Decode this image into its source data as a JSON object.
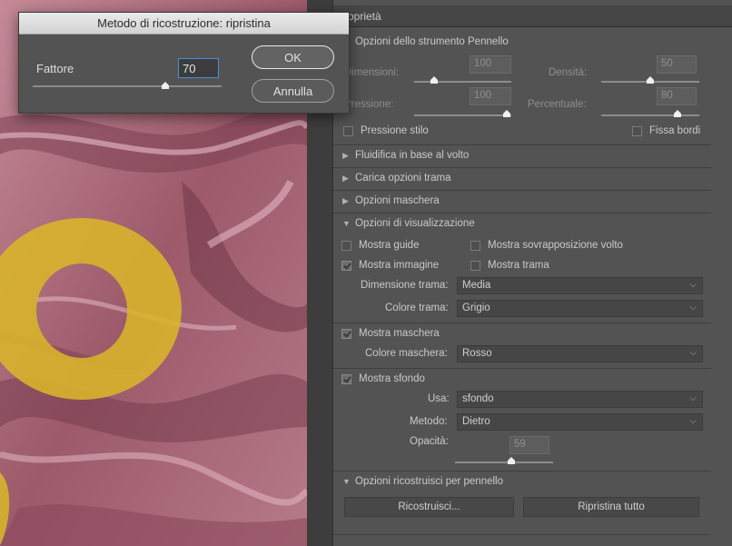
{
  "dialog": {
    "title": "Metodo di ricostruzione: ripristina",
    "factor_label": "Fattore",
    "factor_value": "70",
    "factor_slider_fraction": 0.7,
    "ok_label": "OK",
    "cancel_label": "Annulla"
  },
  "panel": {
    "title": "oprietà",
    "brush_section": "Opzioni dello strumento Pennello",
    "size_label": "Dimensioni:",
    "size_value": "100",
    "density_label": "Densità:",
    "density_value": "50",
    "pressure_label": "Pressione:",
    "pressure_value": "100",
    "rate_label": "Percentuale:",
    "rate_value": "80",
    "stylus_label": "Pressione stilo",
    "pin_edges_label": "Fissa bordi",
    "face_section": "Fluidifica in base al volto",
    "load_mesh_section": "Carica opzioni trama",
    "mask_section": "Opzioni maschera",
    "view_section": "Opzioni di visualizzazione",
    "show_guides": "Mostra guide",
    "show_face_overlay": "Mostra sovrapposizione volto",
    "show_image": "Mostra immagine",
    "show_mesh": "Mostra trama",
    "mesh_size_label": "Dimensione trama:",
    "mesh_size_value": "Media",
    "mesh_color_label": "Colore trama:",
    "mesh_color_value": "Grigio",
    "show_mask": "Mostra maschera",
    "mask_color_label": "Colore maschera:",
    "mask_color_value": "Rosso",
    "show_backdrop": "Mostra sfondo",
    "use_label": "Usa:",
    "use_value": "sfondo",
    "mode_label": "Metodo:",
    "mode_value": "Dietro",
    "opacity_label": "Opacità:",
    "opacity_value": "59",
    "reconstruct_section": "Opzioni ricostruisci per pennello",
    "reconstruct_button": "Ricostruisci...",
    "restore_all_button": "Ripristina tutto"
  },
  "colors": {
    "fabric": "#a86a78",
    "mask_yellow": "#d9b52a",
    "panel_bg": "#535353"
  }
}
